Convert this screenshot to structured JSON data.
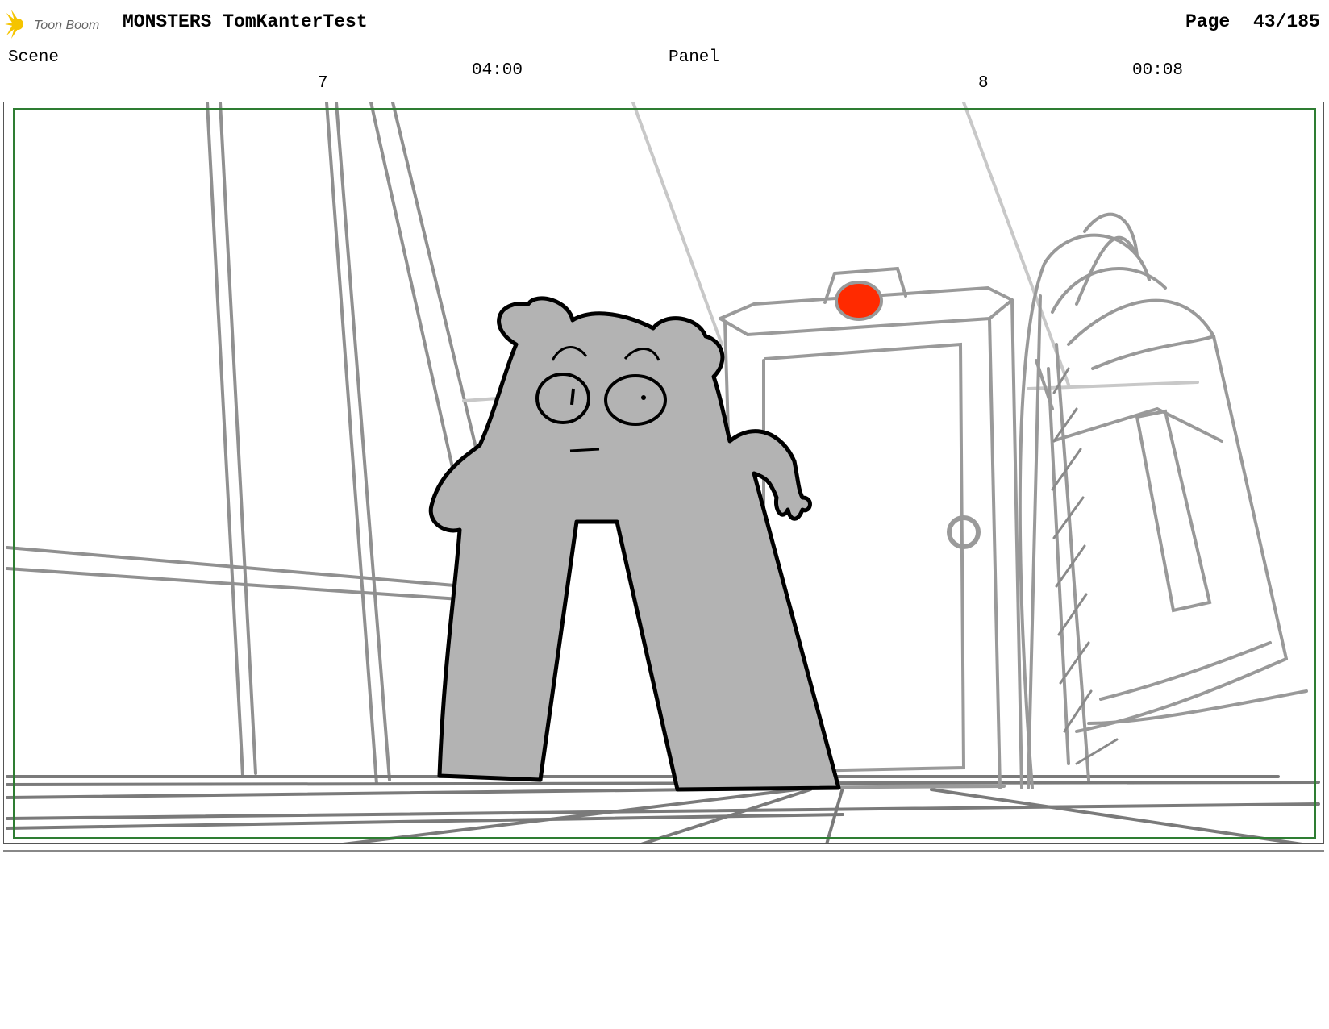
{
  "header": {
    "logo_text": "Toon Boom",
    "project_title": "MONSTERS TomKanterTest",
    "page_label": "Page",
    "page_value": "43/185"
  },
  "scene": {
    "label": "Scene",
    "number": "7",
    "duration": "04:00"
  },
  "panel": {
    "label": "Panel",
    "number": "8",
    "duration": "00:08"
  },
  "colors": {
    "safe_area_border": "#2e7d32",
    "character_fill": "#b3b3b3",
    "alarm_light": "#ff2a00",
    "logo_accent": "#f5c400"
  }
}
